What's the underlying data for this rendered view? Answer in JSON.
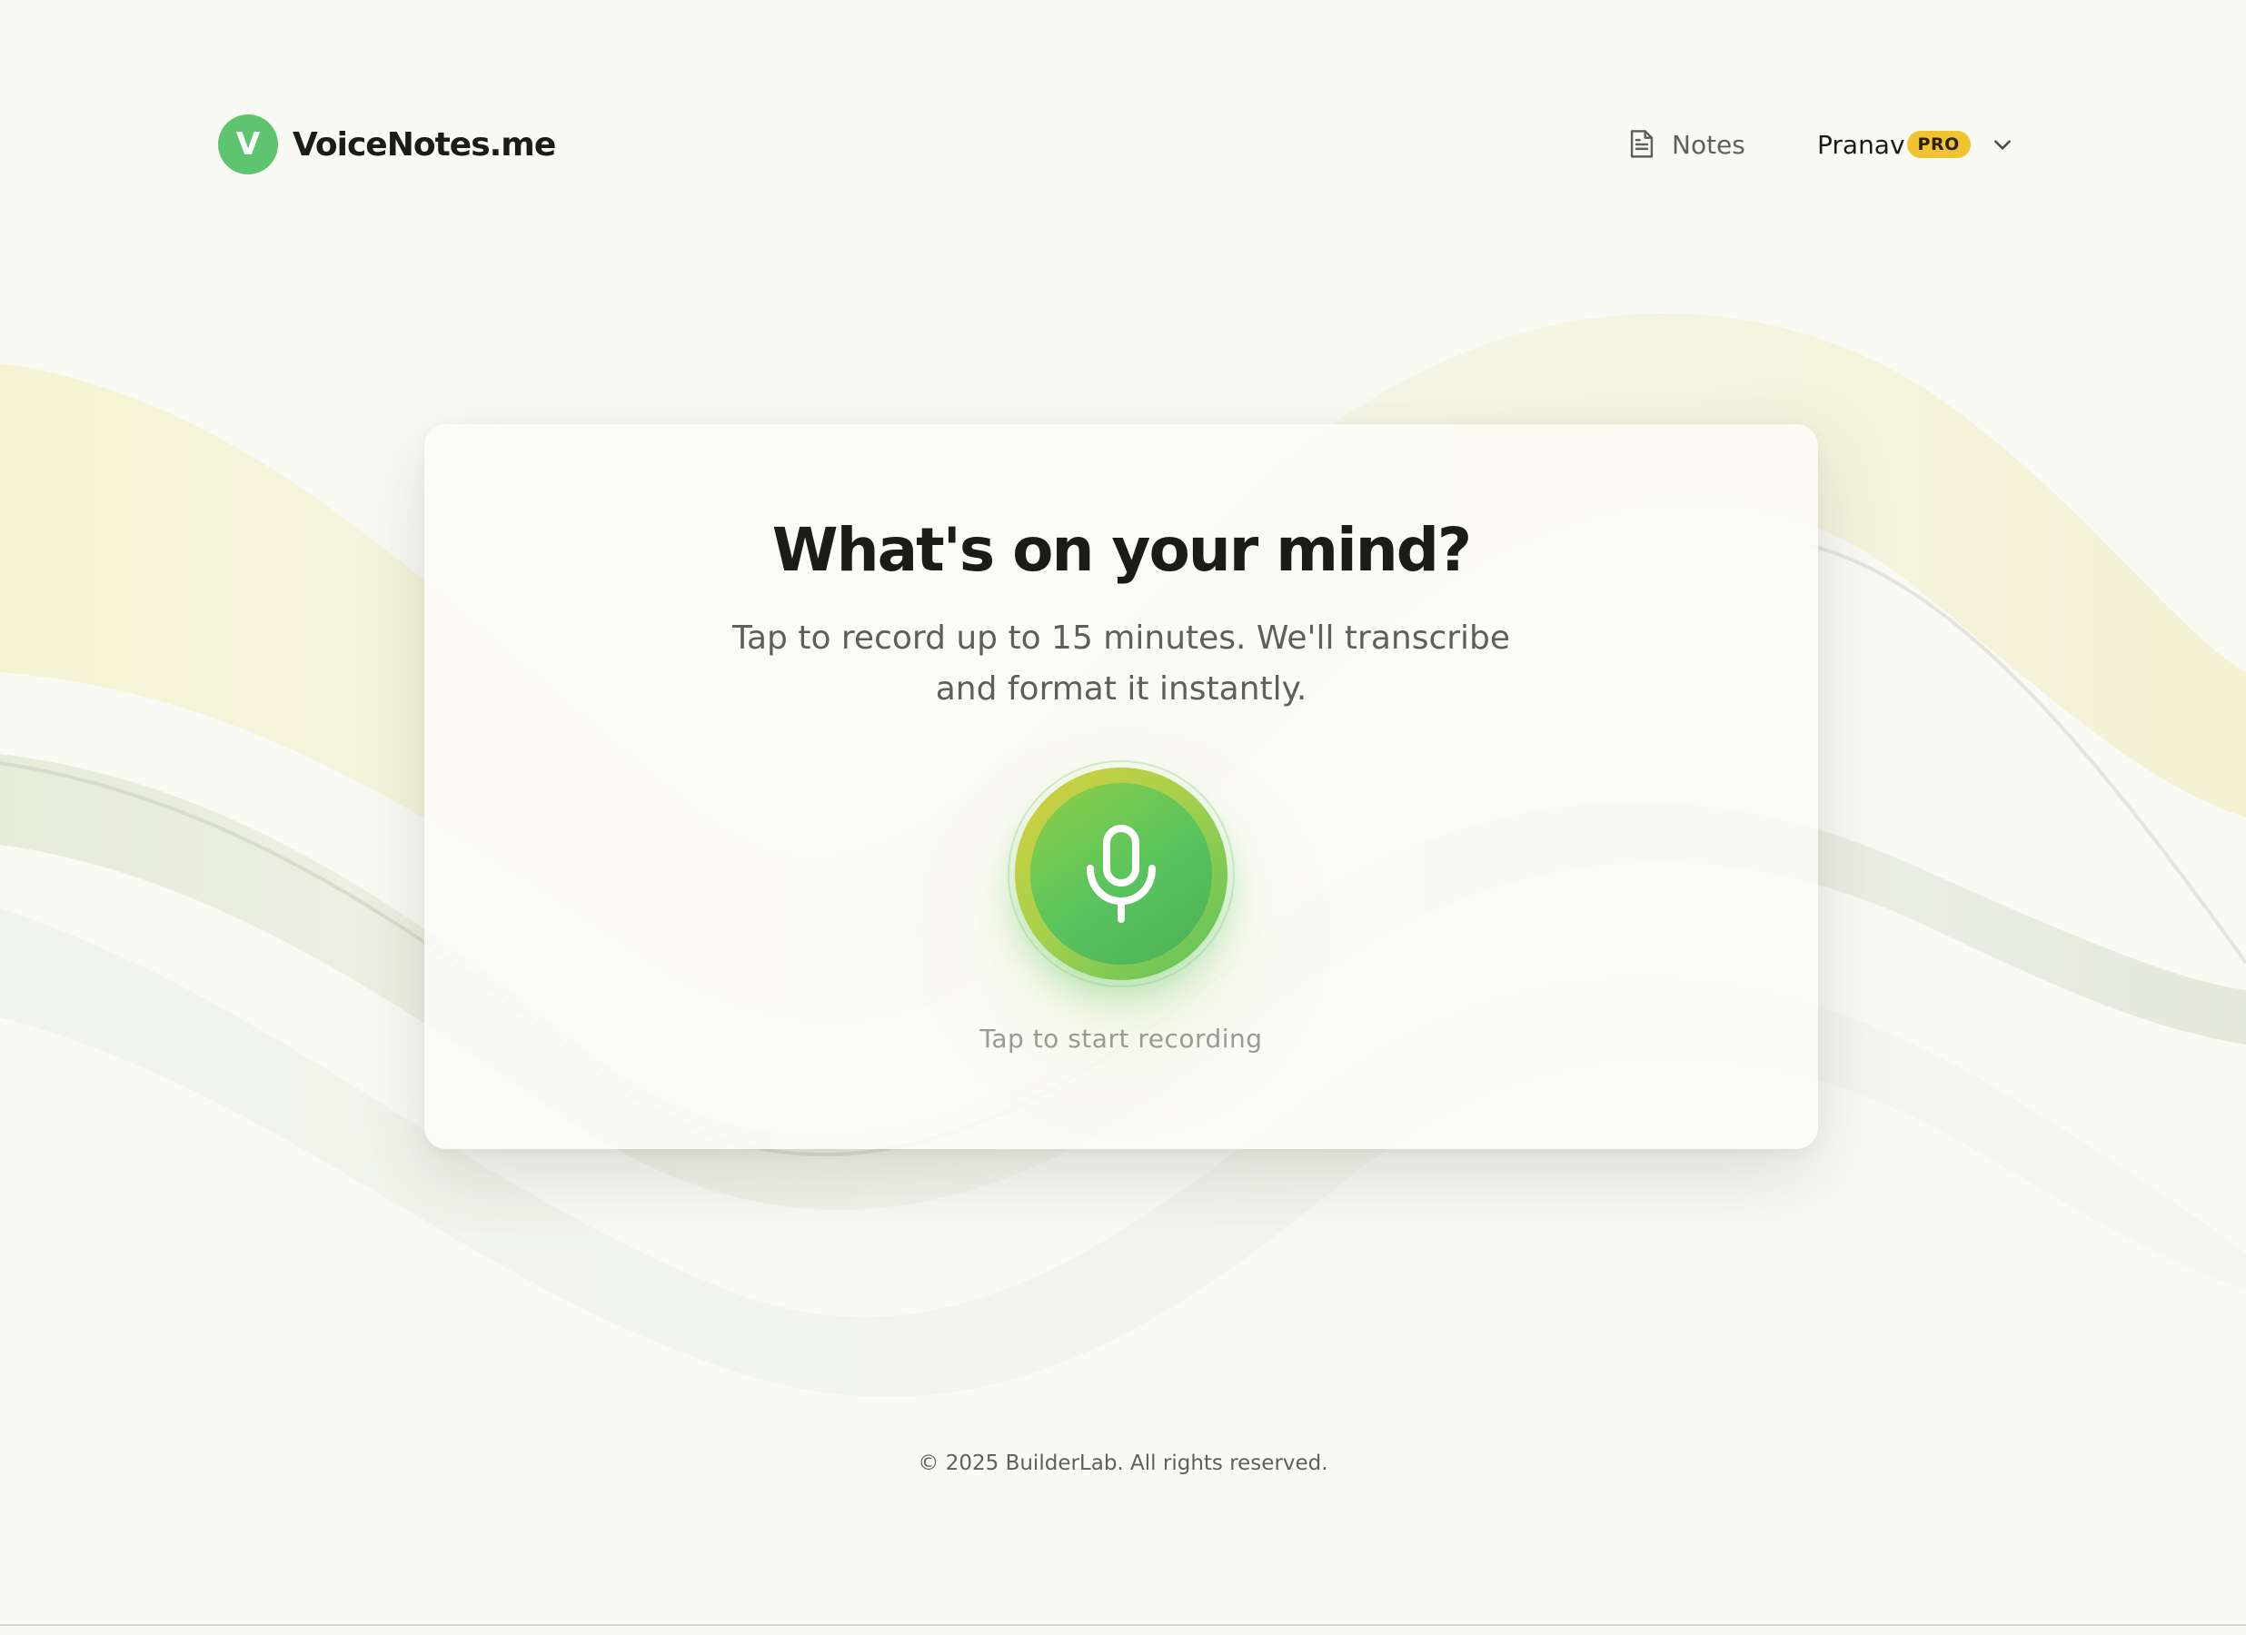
{
  "header": {
    "logo_letter": "V",
    "brand_name": "VoiceNotes.me",
    "notes_label": "Notes",
    "notes_icon": "document-icon",
    "user_name": "Pranav",
    "user_badge": "PRO",
    "user_menu_icon": "chevron-down-icon"
  },
  "main": {
    "headline": "What's on your mind?",
    "subtitle": "Tap to record up to 15 minutes. We'll transcribe and format it instantly.",
    "record_icon": "microphone-icon",
    "record_caption": "Tap to start recording"
  },
  "footer": {
    "copyright": "© 2025 BuilderLab. All rights reserved."
  },
  "colors": {
    "brand_green": "#5fc46f",
    "pro_badge": "#f0c330",
    "background": "#fafaf5",
    "mic_gradient_start": "#d6cf3e",
    "mic_gradient_end": "#58c35e"
  }
}
